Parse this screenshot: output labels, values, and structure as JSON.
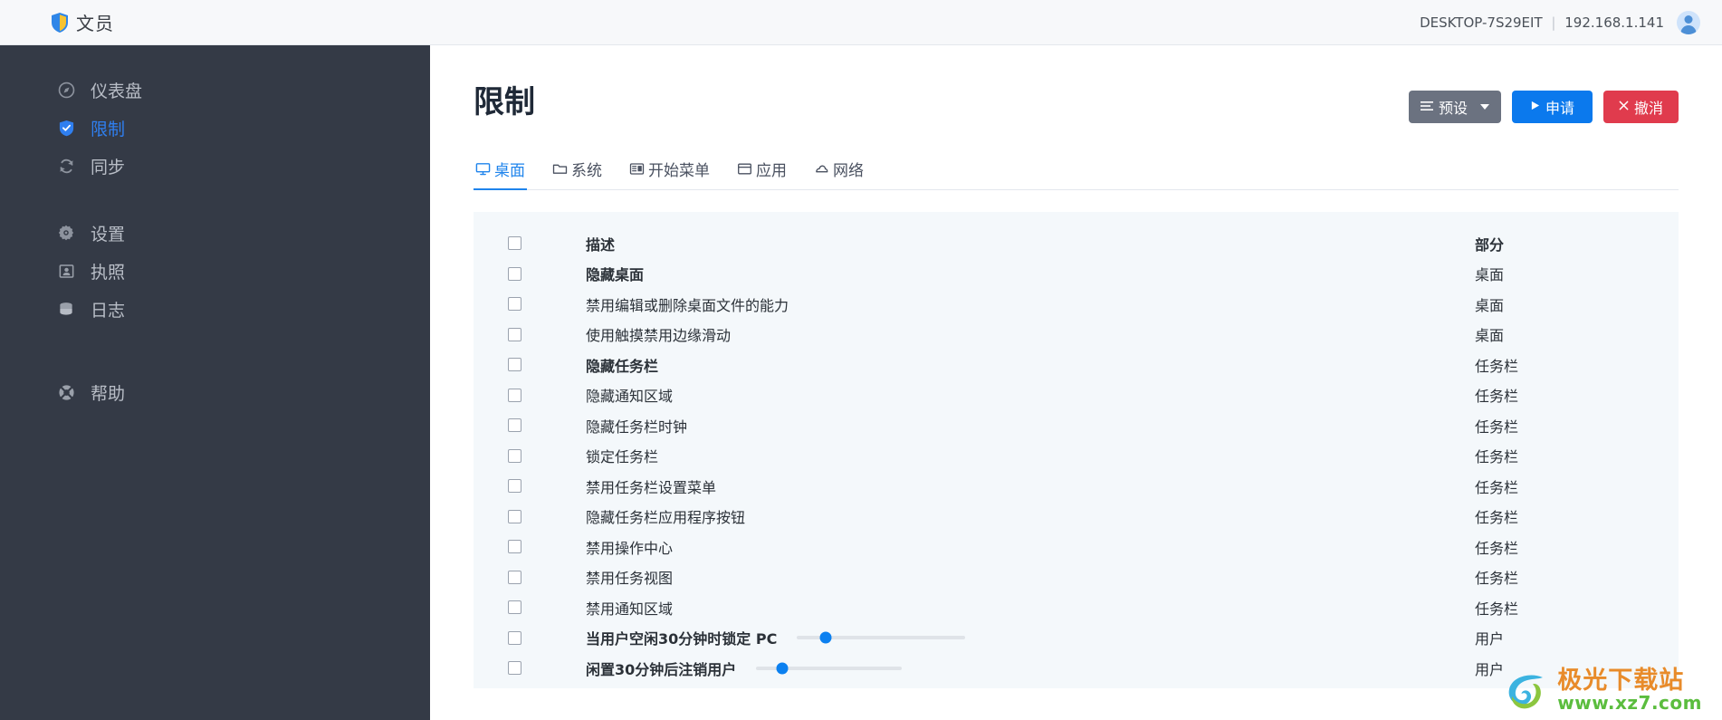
{
  "topbar": {
    "brand_name": "文员",
    "brand_icon": "shield-logo-icon",
    "host_name": "DESKTOP-7S29EIT",
    "separator": "|",
    "ip_address": "192.168.1.141",
    "avatar_icon": "user-avatar-icon"
  },
  "sidebar": {
    "items": [
      {
        "label": "仪表盘",
        "icon": "compass-icon",
        "active": false
      },
      {
        "label": "限制",
        "icon": "shield-check-icon",
        "active": true
      },
      {
        "label": "同步",
        "icon": "sync-icon",
        "active": false
      },
      {
        "label": "设置",
        "icon": "gear-icon",
        "active": false
      },
      {
        "label": "执照",
        "icon": "license-icon",
        "active": false
      },
      {
        "label": "日志",
        "icon": "database-icon",
        "active": false
      },
      {
        "label": "帮助",
        "icon": "lifebuoy-icon",
        "active": false
      }
    ]
  },
  "page": {
    "title": "限制",
    "buttons": {
      "preset": {
        "label": "预设",
        "icon": "list-icon",
        "color": "#6b7280"
      },
      "apply": {
        "label": "申请",
        "icon": "play-icon",
        "color": "#0b79ed"
      },
      "cancel": {
        "label": "撤消",
        "icon": "close-icon",
        "color": "#e03b4d"
      }
    }
  },
  "tabs": [
    {
      "label": "桌面",
      "icon": "monitor-icon",
      "active": true
    },
    {
      "label": "系统",
      "icon": "folder-icon",
      "active": false
    },
    {
      "label": "开始菜单",
      "icon": "startmenu-icon",
      "active": false
    },
    {
      "label": "应用",
      "icon": "window-icon",
      "active": false
    },
    {
      "label": "网络",
      "icon": "cloud-icon",
      "active": false
    }
  ],
  "table": {
    "headers": {
      "description": "描述",
      "section": "部分"
    },
    "rows": [
      {
        "description": "隐藏桌面",
        "section": "桌面",
        "bold": true,
        "slider": null
      },
      {
        "description": "禁用编辑或删除桌面文件的能力",
        "section": "桌面",
        "bold": false,
        "slider": null
      },
      {
        "description": "使用触摸禁用边缘滑动",
        "section": "桌面",
        "bold": false,
        "slider": null
      },
      {
        "description": "隐藏任务栏",
        "section": "任务栏",
        "bold": true,
        "slider": null
      },
      {
        "description": "隐藏通知区域",
        "section": "任务栏",
        "bold": false,
        "slider": null
      },
      {
        "description": "隐藏任务栏时钟",
        "section": "任务栏",
        "bold": false,
        "slider": null
      },
      {
        "description": "锁定任务栏",
        "section": "任务栏",
        "bold": false,
        "slider": null
      },
      {
        "description": "禁用任务栏设置菜单",
        "section": "任务栏",
        "bold": false,
        "slider": null
      },
      {
        "description": "隐藏任务栏应用程序按钮",
        "section": "任务栏",
        "bold": false,
        "slider": null
      },
      {
        "description": "禁用操作中心",
        "section": "任务栏",
        "bold": false,
        "slider": null
      },
      {
        "description": "禁用任务视图",
        "section": "任务栏",
        "bold": false,
        "slider": null
      },
      {
        "description": "禁用通知区域",
        "section": "任务栏",
        "bold": false,
        "slider": null
      },
      {
        "description": "当用户空闲30分钟时锁定 PC",
        "section": "用户",
        "bold": true,
        "slider": {
          "track_width": 186,
          "knob_percent": 17
        }
      },
      {
        "description": "闲置30分钟后注销用户",
        "section": "用户",
        "bold": true,
        "slider": {
          "track_width": 161,
          "knob_percent": 18
        }
      }
    ]
  },
  "watermark": {
    "title": "极光下载站",
    "url": "www.xz7.com",
    "icon": "swirl-logo-icon"
  },
  "colors": {
    "sidebar_bg": "#343a46",
    "accent": "#1f84ec",
    "active_nav": "#2f7ff0",
    "panel_bg": "#f4f8fb",
    "topbar_bg": "#f7f8fa"
  }
}
